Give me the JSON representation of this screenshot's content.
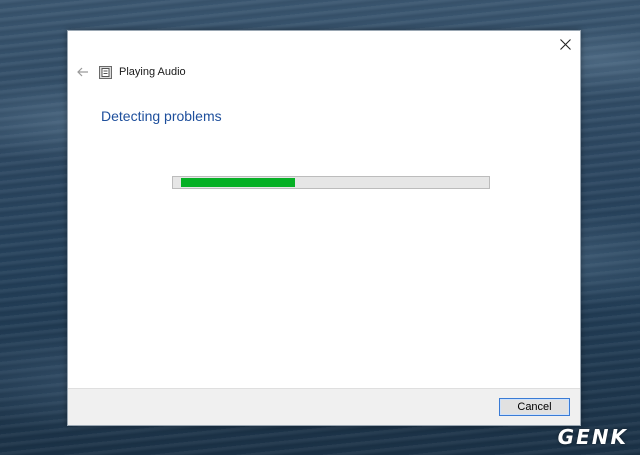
{
  "window": {
    "title": "Playing Audio",
    "heading": "Detecting problems",
    "progress_fraction": 0.36,
    "progress_color": "#06b025",
    "icons": {
      "close": "close-icon",
      "back": "back-arrow-icon",
      "app": "troubleshooter-icon"
    }
  },
  "footer": {
    "cancel_label": "Cancel"
  },
  "watermark": {
    "text": "GENK"
  }
}
